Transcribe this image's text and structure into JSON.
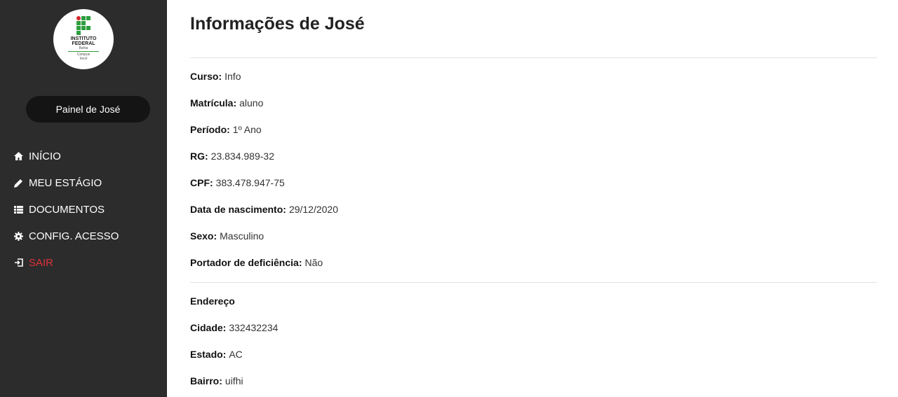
{
  "sidebar": {
    "logo": {
      "line1": "INSTITUTO",
      "line2": "FEDERAL",
      "line3": "Bahia",
      "line4": "Campus",
      "line5": "Irecê"
    },
    "panel_label": "Painel de José",
    "items": [
      {
        "label": "INÍCIO",
        "icon": "home-icon"
      },
      {
        "label": "MEU ESTÁGIO",
        "icon": "pencil-icon"
      },
      {
        "label": "DOCUMENTOS",
        "icon": "list-icon"
      },
      {
        "label": "CONFIG. ACESSO",
        "icon": "gear-icon"
      },
      {
        "label": "SAIR",
        "icon": "sign-in-icon"
      }
    ]
  },
  "main": {
    "title": "Informações de José",
    "fields": [
      {
        "label": "Curso:",
        "value": "Info"
      },
      {
        "label": "Matrícula:",
        "value": "aluno"
      },
      {
        "label": "Período:",
        "value": "1º Ano"
      },
      {
        "label": "RG:",
        "value": "23.834.989-32"
      },
      {
        "label": "CPF:",
        "value": "383.478.947-75"
      },
      {
        "label": "Data de nascimento:",
        "value": "29/12/2020"
      },
      {
        "label": "Sexo:",
        "value": "Masculino"
      },
      {
        "label": "Portador de deficiência:",
        "value": "Não"
      }
    ],
    "address_heading": "Endereço",
    "address": [
      {
        "label": "Cidade:",
        "value": "332432234"
      },
      {
        "label": "Estado:",
        "value": "AC"
      },
      {
        "label": "Bairro:",
        "value": "uifhi"
      }
    ]
  },
  "colors": {
    "sidebar": "#2c2c2c",
    "logout": "#e0313a"
  }
}
